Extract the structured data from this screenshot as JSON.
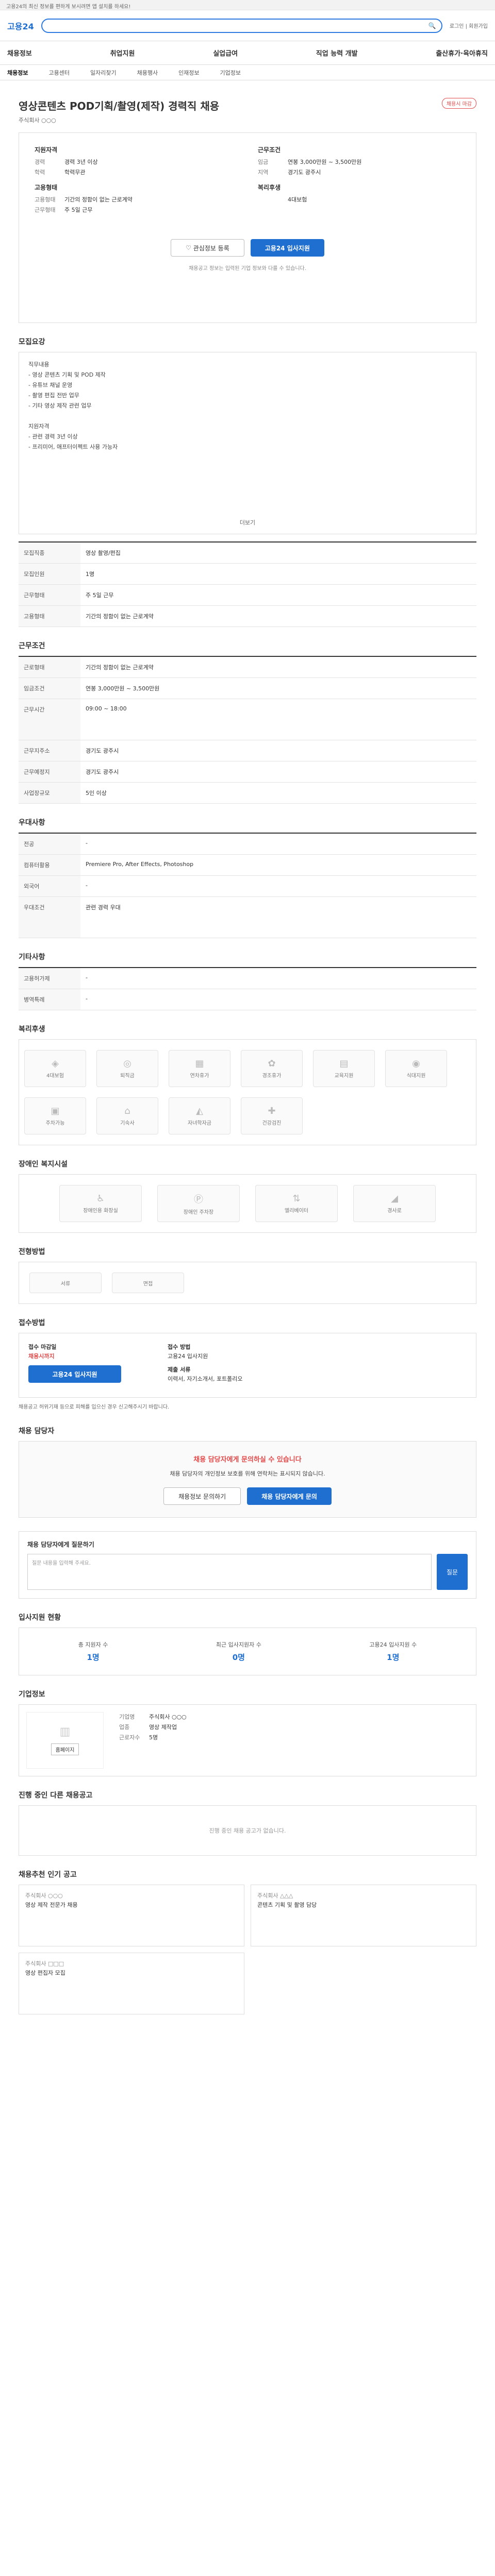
{
  "top_strip": "고용24의 최신 정보를 편하게 보시려면 앱 설치를 하세요!",
  "header": {
    "logo": "고용24",
    "links": "로그인 | 회원가입"
  },
  "gnb": [
    "채용정보",
    "취업지원",
    "실업급여",
    "직업 능력 개발",
    "출산휴가·육아휴직"
  ],
  "subnav": [
    "채용정보",
    "고용센터",
    "일자리찾기",
    "채용행사",
    "인재정보",
    "기업정보"
  ],
  "title": "영상콘텐츠 POD기획/촬영(제작) 경력직 채용",
  "badge": "채용시 마감",
  "company_sub": "주식회사 ○○○",
  "summary": {
    "left_title": "지원자격",
    "left": [
      [
        "경력",
        "경력 3년 이상"
      ],
      [
        "학력",
        "학력무관"
      ]
    ],
    "right_title": "근무조건",
    "right": [
      [
        "임금",
        "연봉 3,000만원 ~ 3,500만원"
      ],
      [
        "지역",
        "경기도 광주시"
      ]
    ],
    "left2_title": "고용형태",
    "left2": [
      [
        "고용형태",
        "기간의 정함이 없는 근로계약"
      ],
      [
        "근무형태",
        "주 5일 근무"
      ]
    ],
    "right2_title": "복리후생",
    "right2": [
      [
        "",
        "4대보험"
      ]
    ],
    "interest_btn": "관심정보 등록",
    "apply_btn": "고용24 입사지원",
    "note": "채용공고 정보는 입력된 기업 정보와 다를 수 있습니다."
  },
  "sections": {
    "job": "모집요강",
    "job_text": "직무내용\n - 영상 콘텐츠 기획 및 POD 제작\n - 유튜브 채널 운영\n - 촬영 편집 전반 업무\n - 기타 영상 제작 관련 업무\n\n지원자격\n - 관련 경력 3년 이상\n - 프리미어, 애프터이펙트 사용 가능자",
    "more": "더보기",
    "info_rows": [
      [
        "모집직종",
        "영상 촬영/편집"
      ],
      [
        "모집인원",
        "1명"
      ],
      [
        "근무형태",
        "주 5일 근무"
      ],
      [
        "고용형태",
        "기간의 정함이 없는 근로계약"
      ]
    ],
    "work_title": "근무조건",
    "work_rows": [
      [
        "근로형태",
        "기간의 정함이 없는 근로계약"
      ],
      [
        "임금조건",
        "연봉 3,000만원 ~ 3,500만원"
      ],
      [
        "근무시간",
        "09:00 ~ 18:00"
      ],
      [
        "근무지주소",
        "경기도 광주시"
      ],
      [
        "근무예정지",
        "경기도 광주시"
      ],
      [
        "사업장규모",
        "5인 이상"
      ]
    ],
    "qual_title": "우대사항",
    "qual_rows": [
      [
        "전공",
        "-"
      ],
      [
        "컴퓨터활용",
        "Premiere Pro, After Effects, Photoshop"
      ],
      [
        "외국어",
        "-"
      ],
      [
        "우대조건",
        "관련 경력 우대"
      ]
    ],
    "etc_title": "기타사항",
    "etc_rows": [
      [
        "고용허가제",
        "-"
      ],
      [
        "병역특례",
        "-"
      ]
    ],
    "welfare_title": "복리후생",
    "welfare_items": [
      "4대보험",
      "퇴직금",
      "연차휴가",
      "경조휴가",
      "교육지원",
      "식대지원",
      "주차가능",
      "기숙사",
      "자녀학자금",
      "건강검진"
    ],
    "disabled_title": "장애인 복지시설",
    "disabled_items": [
      "장애인용 화장실",
      "장애인 주차장",
      "엘리베이터",
      "경사로"
    ],
    "process_title": "전형방법",
    "process_steps": [
      "서류",
      "면접"
    ],
    "apply_title": "접수방법",
    "apply_deadline_k": "접수 마감일",
    "apply_deadline_v": "채용시까지",
    "apply_method_k": "접수 방법",
    "apply_method_v": "고용24 입사지원",
    "apply_doc_k": "제출 서류",
    "apply_doc_v": "이력서, 자기소개서, 포트폴리오",
    "warning": "채용공고 허위기재 등으로 피해를 입으신 경우 신고해주시기 바랍니다.",
    "consult_title": "채용 담당자",
    "consult_headline": "채용 담당자에게 문의하실 수 있습니다",
    "consult_text": "채용 담당자의 개인정보 보호를 위해 연락처는 표시되지 않습니다.",
    "consult_btn1": "채용정보 문의하기",
    "consult_btn2": "채용 담당자에게 문의",
    "qna_title": "채용 담당자에게 질문하기",
    "qna_placeholder": "질문 내용을 입력해 주세요.",
    "qna_btn": "질문",
    "stats_title": "입사지원 현황",
    "stats": [
      [
        "총 지원자 수",
        "1명"
      ],
      [
        "최근 입사지원자 수",
        "0명"
      ],
      [
        "고용24 입사지원 수",
        "1명"
      ]
    ],
    "company_title": "기업정보",
    "company_rows": [
      [
        "기업명",
        "주식회사 ○○○"
      ],
      [
        "업종",
        "영상 제작업"
      ],
      [
        "근로자수",
        "5명"
      ]
    ],
    "home_btn": "홈페이지",
    "other_title": "진행 중인 다른 채용공고",
    "other_empty": "진행 중인 채용 공고가 없습니다.",
    "rec_title": "채용추천 인기 공고",
    "rec": [
      [
        "주식회사 ○○○",
        "영상 제작 전문가 채용"
      ],
      [
        "주식회사 △△△",
        "콘텐츠 기획 및 촬영 담당"
      ],
      [
        "주식회사 □□□",
        "영상 편집자 모집"
      ]
    ]
  }
}
